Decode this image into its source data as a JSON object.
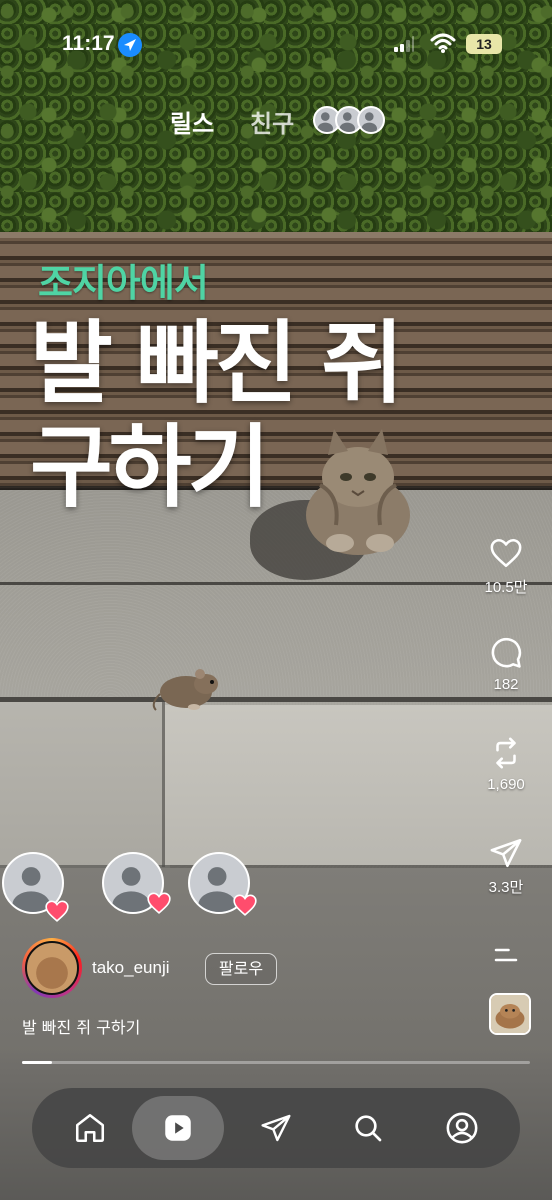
{
  "status_bar": {
    "time": "11:17",
    "battery": "13",
    "icons": [
      "location-arrow-icon",
      "signal-icon",
      "wifi-icon",
      "battery-icon"
    ]
  },
  "top_tabs": {
    "reels_label": "릴스",
    "friends_label": "친구"
  },
  "overlay": {
    "line_small": "조지아에서",
    "line_big_1": "발 빠진 쥐",
    "line_big_2": "구하기",
    "accent_color": "#4fd4a4"
  },
  "actions": {
    "like_count": "10.5만",
    "comment_count": "182",
    "repost_count": "1,690",
    "share_count": "3.3만",
    "icons": [
      "heart-icon",
      "comment-icon",
      "repost-icon",
      "send-icon",
      "more-icon"
    ]
  },
  "author": {
    "username": "tako_eunji",
    "follow_label": "팔로우",
    "caption": "발 빠진 쥐 구하기"
  },
  "progress_fraction": 0.06,
  "bottom_nav": {
    "items": [
      "home-icon",
      "reels-icon",
      "send-icon",
      "search-icon",
      "profile-icon"
    ],
    "active": "reels-icon"
  }
}
